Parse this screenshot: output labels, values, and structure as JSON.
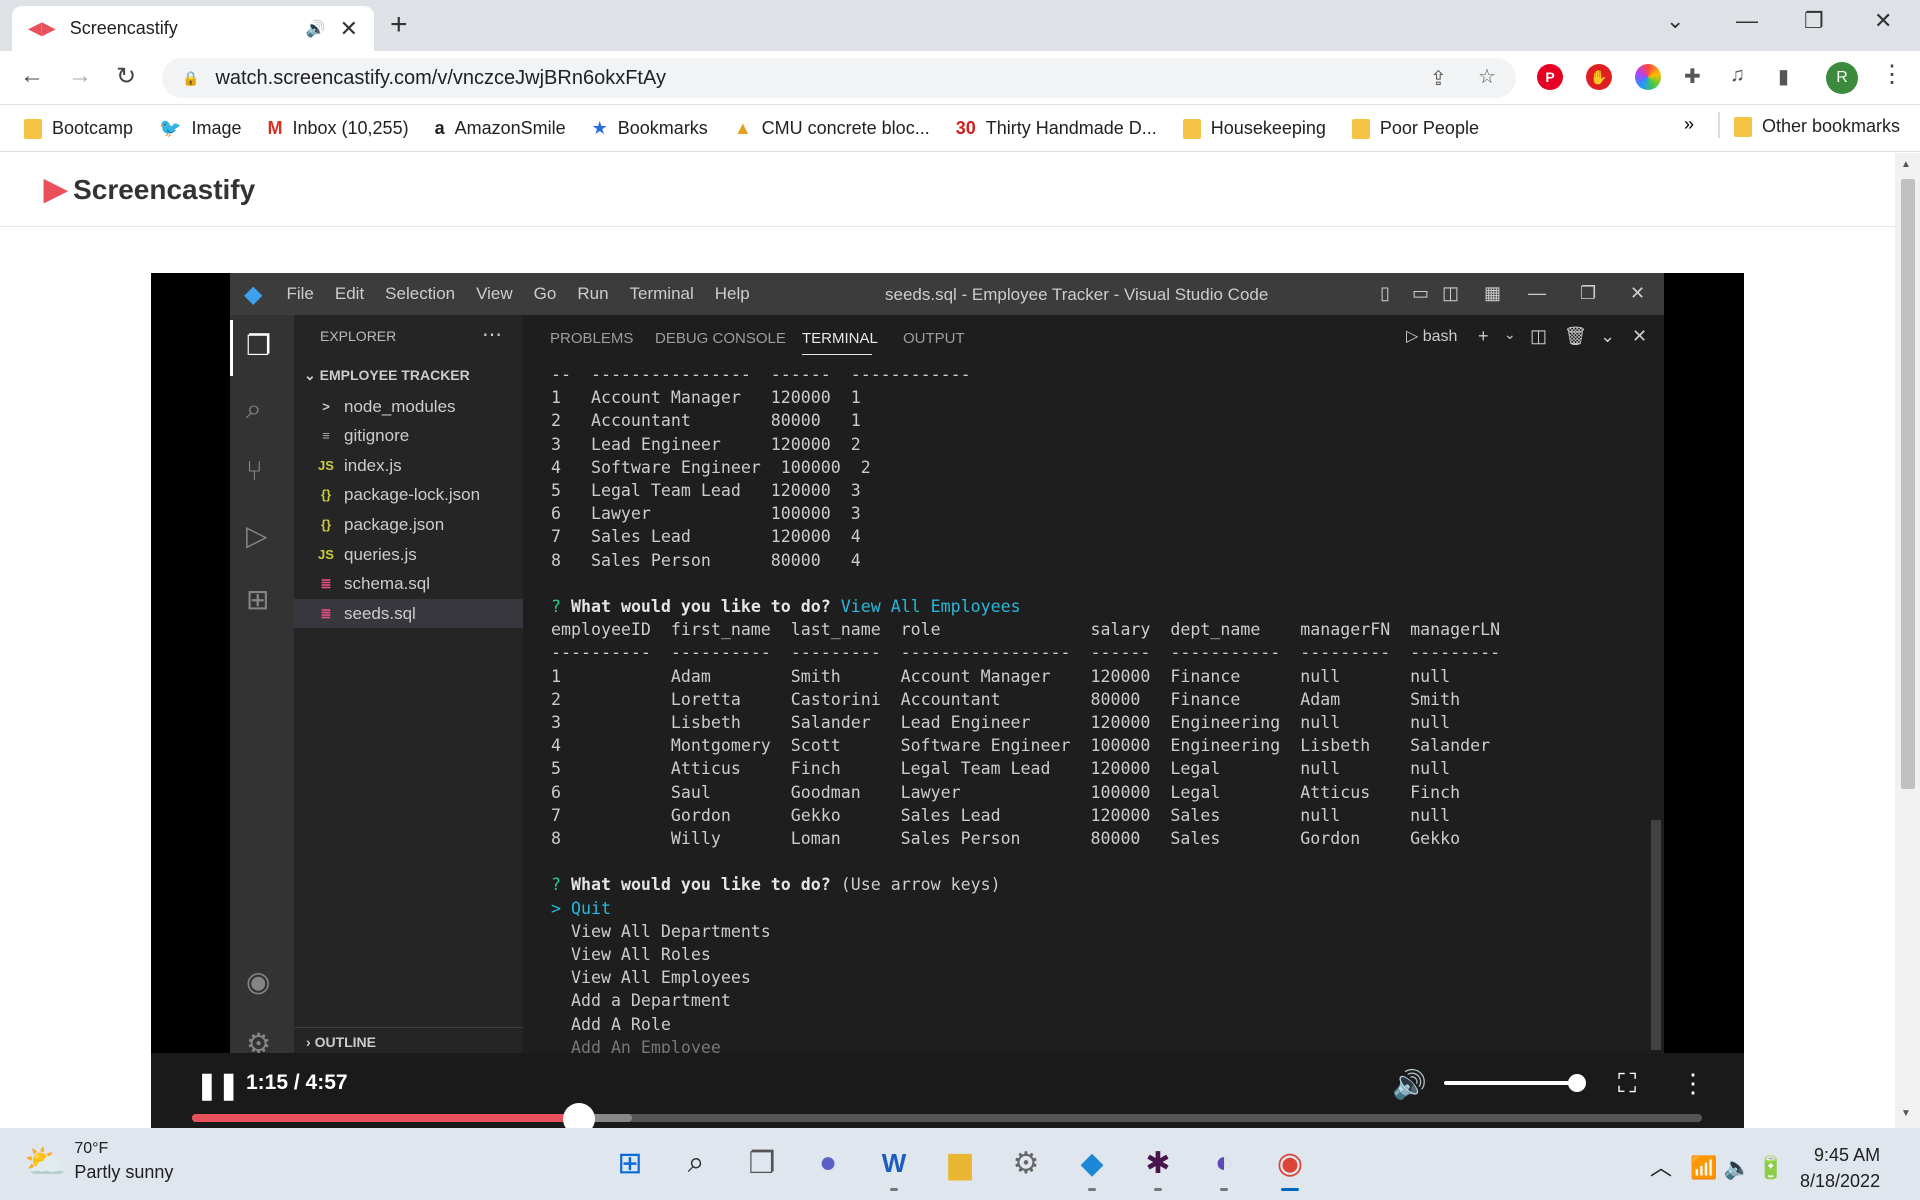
{
  "browser": {
    "tab_title": "Screencastify",
    "url": "watch.screencastify.com/v/vnczceJwjBRn6okxFtAy",
    "bookmarks": [
      {
        "label": "Bootcamp",
        "icon": "folder-icon"
      },
      {
        "label": "Image",
        "icon": "twitter-icon"
      },
      {
        "label": "Inbox (10,255)",
        "icon": "gmail-icon"
      },
      {
        "label": "AmazonSmile",
        "icon": "amazon-icon"
      },
      {
        "label": "Bookmarks",
        "icon": "star-icon"
      },
      {
        "label": "CMU concrete bloc...",
        "icon": "site-icon"
      },
      {
        "label": "Thirty Handmade D...",
        "icon": "site-30-icon"
      },
      {
        "label": "Housekeeping",
        "icon": "folder-icon"
      },
      {
        "label": "Poor People",
        "icon": "folder-icon"
      }
    ],
    "bookmarks_more": "»",
    "other_bookmarks": "Other bookmarks",
    "profile_initial": "R"
  },
  "page": {
    "brand": "Screencastify"
  },
  "vscode": {
    "menu": [
      "File",
      "Edit",
      "Selection",
      "View",
      "Go",
      "Run",
      "Terminal",
      "Help"
    ],
    "window_title": "seeds.sql - Employee Tracker - Visual Studio Code",
    "explorer_title": "EXPLORER",
    "project_name": "EMPLOYEE TRACKER",
    "files": [
      {
        "name": "node_modules",
        "icon": ">"
      },
      {
        "name": "gitignore",
        "icon": "≡"
      },
      {
        "name": "index.js",
        "icon": "JS"
      },
      {
        "name": "package-lock.json",
        "icon": "{}"
      },
      {
        "name": "package.json",
        "icon": "{}"
      },
      {
        "name": "queries.js",
        "icon": "JS"
      },
      {
        "name": "schema.sql",
        "icon": "≣"
      },
      {
        "name": "seeds.sql",
        "icon": "≣"
      }
    ],
    "outline_label": "OUTLINE",
    "panel_tabs": [
      "PROBLEMS",
      "DEBUG CONSOLE",
      "TERMINAL",
      "OUTPUT"
    ],
    "shell": "bash",
    "terminal": {
      "roles_divider": "--  ----------------  ------  ------------",
      "roles_rows": [
        "1   Account Manager   120000  1",
        "2   Accountant        80000   1",
        "3   Lead Engineer     120000  2",
        "4   Software Engineer  100000  2",
        "5   Legal Team Lead   120000  3",
        "6   Lawyer            100000  3",
        "7   Sales Lead        120000  4",
        "8   Sales Person      80000   4"
      ],
      "prompt_mark": "?",
      "prompt1_text": "What would you like to do?",
      "prompt1_answer": "View All Employees",
      "emp_header": "employeeID  first_name  last_name  role               salary  dept_name    managerFN  managerLN",
      "emp_divider": "----------  ----------  ---------  -----------------  ------  -----------  ---------  ---------",
      "emp_rows": [
        "1           Adam        Smith      Account Manager    120000  Finance      null       null",
        "2           Loretta     Castorini  Accountant         80000   Finance      Adam       Smith",
        "3           Lisbeth     Salander   Lead Engineer      120000  Engineering  null       null",
        "4           Montgomery  Scott      Software Engineer  100000  Engineering  Lisbeth    Salander",
        "5           Atticus     Finch      Legal Team Lead    120000  Legal        null       null",
        "6           Saul        Goodman    Lawyer             100000  Legal        Atticus    Finch",
        "7           Gordon      Gekko      Sales Lead         120000  Sales        null       null",
        "8           Willy       Loman      Sales Person       80000   Sales        Gordon     Gekko"
      ],
      "prompt2_text": "What would you like to do?",
      "prompt2_hint": "(Use arrow keys)",
      "selected_choice": "Quit",
      "choices": [
        "View All Departments",
        "View All Roles",
        "View All Employees",
        "Add a Department",
        "Add A Role",
        "Add An Employee"
      ]
    }
  },
  "video": {
    "time": "1:15 / 4:57",
    "progress": 0.256,
    "volume": 0.95
  },
  "taskbar": {
    "temp": "70°F",
    "weather": "Partly sunny",
    "time": "9:45 AM",
    "date": "8/18/2022"
  }
}
